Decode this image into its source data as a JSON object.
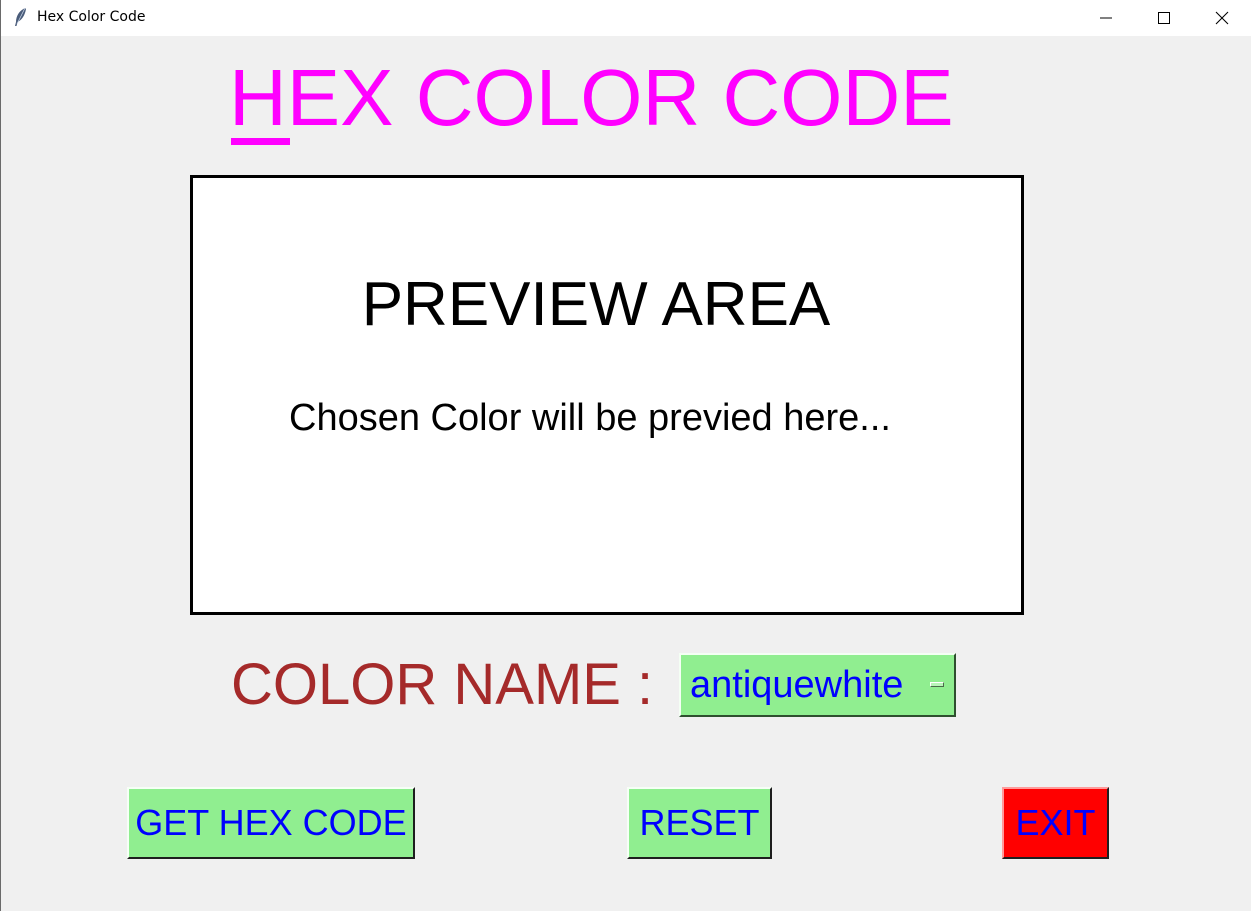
{
  "window": {
    "title": "Hex Color Code",
    "icon": "feather-icon",
    "controls": [
      "minimize-icon",
      "maximize-icon",
      "close-icon"
    ]
  },
  "heading": {
    "text": "HEX COLOR CODE",
    "color": "#ff00ff"
  },
  "preview": {
    "title": "PREVIEW AREA",
    "message": "Chosen Color will be previed here...",
    "background": "#ffffff"
  },
  "color_name": {
    "label": "COLOR NAME :",
    "selected": "antiquewhite",
    "label_color": "#a52a2a"
  },
  "buttons": {
    "get_hex": "GET HEX CODE",
    "reset": "RESET",
    "exit": "EXIT"
  },
  "colors": {
    "button_green": "#90ee90",
    "button_text": "#0000ff",
    "exit_red": "#ff0000"
  }
}
